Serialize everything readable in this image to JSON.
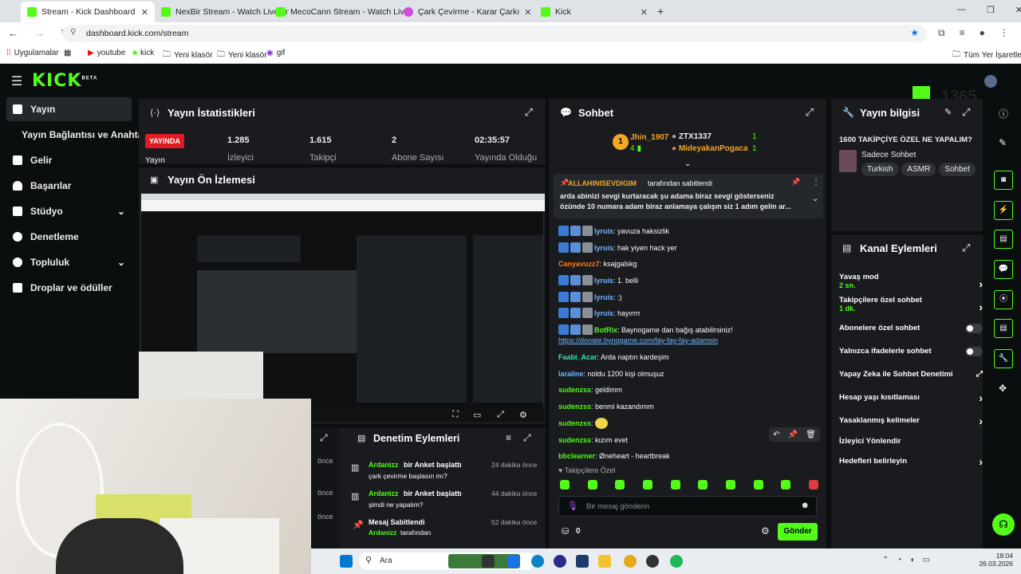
{
  "browser": {
    "tabs": [
      {
        "label": "Stream - Kick Dashboard"
      },
      {
        "label": "NexBir Stream - Watch Live on"
      },
      {
        "label": "MecoCann Stream - Watch Live"
      },
      {
        "label": "Çark Çevirme - Karar Çarkı"
      },
      {
        "label": "Kick"
      }
    ],
    "url": "dashboard.kick.com/stream",
    "bookmarks": [
      "Uygulamalar",
      "youtube",
      "kick",
      "Yeni klasör",
      "Yeni klasör",
      "gif"
    ],
    "all_bookmarks": "Tüm Yer İşaretleri"
  },
  "header": {
    "logo": "KICK",
    "logo_sup": "BETA",
    "overlay_number": "1365"
  },
  "sidebar": {
    "items": [
      {
        "label": "Yayın"
      },
      {
        "label": "Yayın Bağlantısı ve Anahtarı"
      },
      {
        "label": "Gelir"
      },
      {
        "label": "Başarılar"
      },
      {
        "label": "Stüdyo"
      },
      {
        "label": "Denetleme"
      },
      {
        "label": "Topluluk"
      },
      {
        "label": "Droplar ve ödüller"
      }
    ]
  },
  "stats": {
    "title": "Yayın İstatistikleri",
    "live_badge": "YAYINDA",
    "live_label": "Yayın",
    "items": [
      {
        "value": "1.285",
        "label": "İzleyici"
      },
      {
        "value": "1.615",
        "label": "Takipçi"
      },
      {
        "value": "2",
        "label": "Abone Sayısı"
      },
      {
        "value": "02:35:57",
        "label": "Yayında Olduğu"
      }
    ]
  },
  "preview": {
    "title": "Yayın Ön İzlemesi"
  },
  "chat": {
    "title": "Sohbet",
    "leaders": {
      "rank_num": "1",
      "first_name": "Jhin_1907",
      "first_count": "4",
      "others": [
        {
          "name": "ZTX1337",
          "count": "1"
        },
        {
          "name": "MideyakanPogaca",
          "count": "1"
        }
      ]
    },
    "pinned": {
      "by": "ALLAHINISEVDIGIM",
      "by_suffix": "tarafından sabitlendi",
      "text": "arda abinizi sevgi kurtaracak şu adama biraz sevgi gösterseniz özünde 10 numara adam biraz anlamaya çalışın siz 1 adım gelin ar..."
    },
    "messages": [
      {
        "user": "lyruis",
        "text": "yavuza haksizlik",
        "color": "#6fb8ff",
        "badges": true
      },
      {
        "user": "lyruis",
        "text": "hak yiyen hack yer",
        "color": "#6fb8ff",
        "badges": true
      },
      {
        "user": "Canyavuzz7",
        "text": "ksajgalskg",
        "color": "#ff7a1a",
        "badges": false
      },
      {
        "user": "lyruis",
        "text": "1. belli",
        "color": "#6fb8ff",
        "badges": true
      },
      {
        "user": "lyruis",
        "text": ":)",
        "color": "#6fb8ff",
        "badges": true
      },
      {
        "user": "lyruis",
        "text": "hayırrrr",
        "color": "#6fb8ff",
        "badges": true
      },
      {
        "user": "BotRix",
        "text": "Baynogame dan bağış atabilirsiniz!",
        "color": "#53fc18",
        "badges": true
      },
      {
        "user": "",
        "text": "https://donate.bynogame.com/fay-fay-fay-adamsin",
        "color": "#6fb8ff",
        "badges": false
      },
      {
        "user": "Faabi_Acar",
        "text": "Arda naptın kardeşim",
        "color": "#2fe8b0",
        "badges": false
      },
      {
        "user": "laraline",
        "text": "noldu 1200 kişi olmuşuz",
        "color": "#6fb8ff",
        "badges": false
      },
      {
        "user": "sudenzss",
        "text": "geldimm",
        "color": "#53fc18",
        "badges": false
      },
      {
        "user": "sudenzss",
        "text": "benmi kazandımm",
        "color": "#53fc18",
        "badges": false
      },
      {
        "user": "sudenzss",
        "text": "",
        "color": "#53fc18",
        "badges": false
      },
      {
        "user": "sudenzss",
        "text": "kızım evet",
        "color": "#53fc18",
        "badges": false
      },
      {
        "user": "bbclearner",
        "text": "Øneheart - heartbreak",
        "color": "#53fc18",
        "badges": false
      }
    ],
    "followers_only": "Takipçilere Özel",
    "input_placeholder": "Bir mesaj gönderin",
    "points": "0",
    "send": "Gönder"
  },
  "info": {
    "title": "Yayın bilgisi",
    "stream_title": "1600 TAKİPÇİYE ÖZEL NE YAPALIM?",
    "category": "Sadece Sohbet",
    "tags": [
      "Turkish",
      "ASMR",
      "Sohbet"
    ]
  },
  "channel_actions": {
    "title": "Kanal Eylemleri",
    "rows": [
      {
        "label": "Yavaş mod",
        "sub": "2 sn.",
        "ctrl": "chev"
      },
      {
        "label": "Takipçilere özel sohbet",
        "sub": "1 dk.",
        "ctrl": "chev"
      },
      {
        "label": "Abonelere özel sohbet",
        "sub": "",
        "ctrl": "toggle"
      },
      {
        "label": "Yalnızca ifadelerle sohbet",
        "sub": "",
        "ctrl": "toggle"
      },
      {
        "label": "Yapay Zeka ile Sohbet Denetimi",
        "sub": "",
        "ctrl": "ext"
      },
      {
        "label": "Hesap yaşı kısıtlaması",
        "sub": "",
        "ctrl": "chev"
      },
      {
        "label": "Yasaklanmış kelimeler",
        "sub": "",
        "ctrl": "chev"
      },
      {
        "label": "İzleyici Yönlendir",
        "sub": "",
        "ctrl": "none"
      },
      {
        "label": "Hedefleri belirleyin",
        "sub": "",
        "ctrl": "chev"
      }
    ]
  },
  "moderation": {
    "title": "Denetim Eylemleri",
    "left_times": [
      "önce",
      "önce",
      "önce"
    ],
    "items": [
      {
        "user": "Ardanizz",
        "action": "bir Anket başlattı",
        "detail": "çark çevirme başlasın mı?",
        "time": "24 dakika önce"
      },
      {
        "user": "Ardanizz",
        "action": "bir Anket başlattı",
        "detail": "şimdi ne yapalım?",
        "time": "44 dakika önce"
      },
      {
        "user": "Mesaj Sabitlendi",
        "action": "",
        "detail_user": "Ardanizz",
        "detail": "tarafından",
        "time": "52 dakika önce"
      }
    ]
  },
  "taskbar": {
    "search": "Ara",
    "time": "18:04",
    "date": "26.03.2026"
  }
}
